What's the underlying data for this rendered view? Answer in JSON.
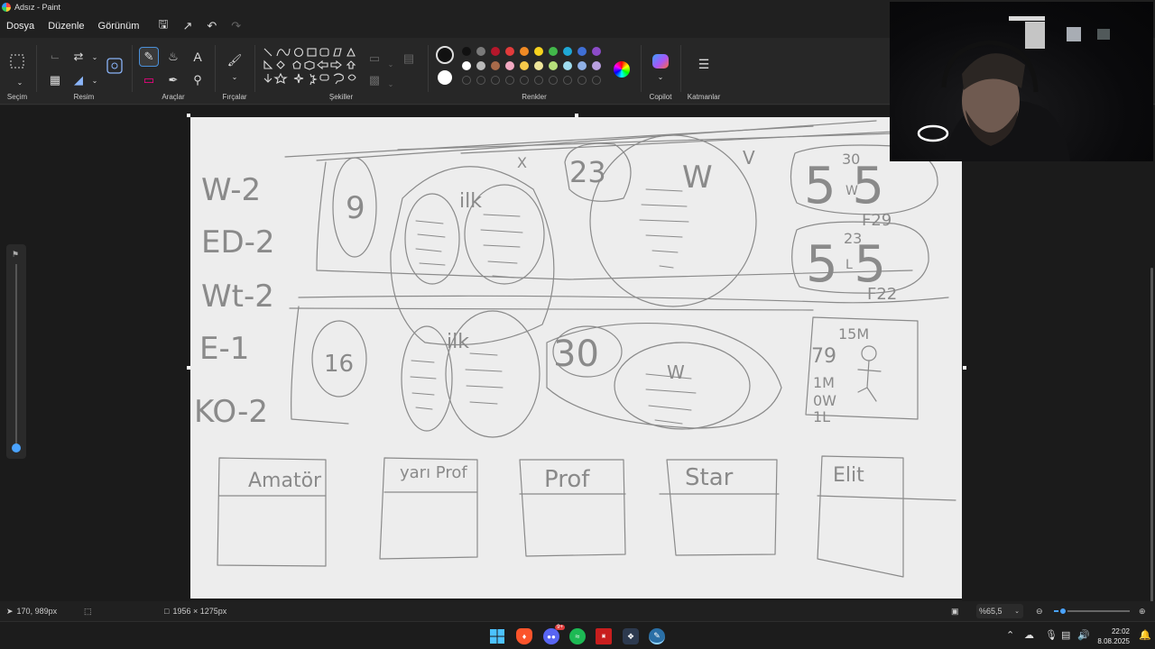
{
  "window": {
    "title": "Adsız - Paint"
  },
  "menu": {
    "file": "Dosya",
    "edit": "Düzenle",
    "view": "Görünüm"
  },
  "ribbon": {
    "groups": {
      "selection": "Seçim",
      "image": "Resim",
      "tools": "Araçlar",
      "brushes": "Fırçalar",
      "shapes": "Şekiller",
      "colors": "Renkler",
      "copilot": "Copilot",
      "layers": "Katmanlar"
    },
    "palette_row1": [
      "#111111",
      "#7a7a7a",
      "#b5172b",
      "#e23b3b",
      "#f08a24",
      "#f7d21e",
      "#42b84a",
      "#1fa8d6",
      "#3f6fd6",
      "#8b4bc8"
    ],
    "palette_row2": [
      "#ffffff",
      "#b9b9b9",
      "#a86a4a",
      "#f3a9c2",
      "#f6c94a",
      "#eee59a",
      "#b6e07a",
      "#9fdcef",
      "#8fb0e6",
      "#b9a0e0"
    ]
  },
  "canvas": {
    "row_labels": [
      "W-2",
      "ED-2",
      "Wt-2",
      "E-1",
      "KO-2"
    ],
    "numbers": {
      "n1": "9",
      "n2": "16",
      "n3": "23",
      "n4": "30"
    },
    "ilk1": "ilk",
    "ilk2": "ilk",
    "w1": "W",
    "w2": "W",
    "x_mark": "X",
    "v_mark": "V",
    "box5_top": {
      "big": "5 5",
      "sup": "30",
      "mid": "W",
      "bottom": "F29"
    },
    "box5_bottom": {
      "big": "5 5",
      "sup": "23",
      "mid": "L",
      "bottom": "F22"
    },
    "right_box": {
      "top": "15M",
      "num": "79",
      "l1": "1M",
      "l2": "0W",
      "l3": "1L"
    },
    "tiers": [
      "Amatör",
      "yarı Prof",
      "Prof",
      "Star",
      "Elit"
    ]
  },
  "status": {
    "cursor": "170, 989px",
    "canvas_size": "1956 × 1275px",
    "zoom": "%65,5",
    "zoom_fraction": 0.12
  },
  "taskbar": {
    "clock_time": "22:02",
    "clock_date": "8.08.2025",
    "discord_badge": "9+"
  }
}
